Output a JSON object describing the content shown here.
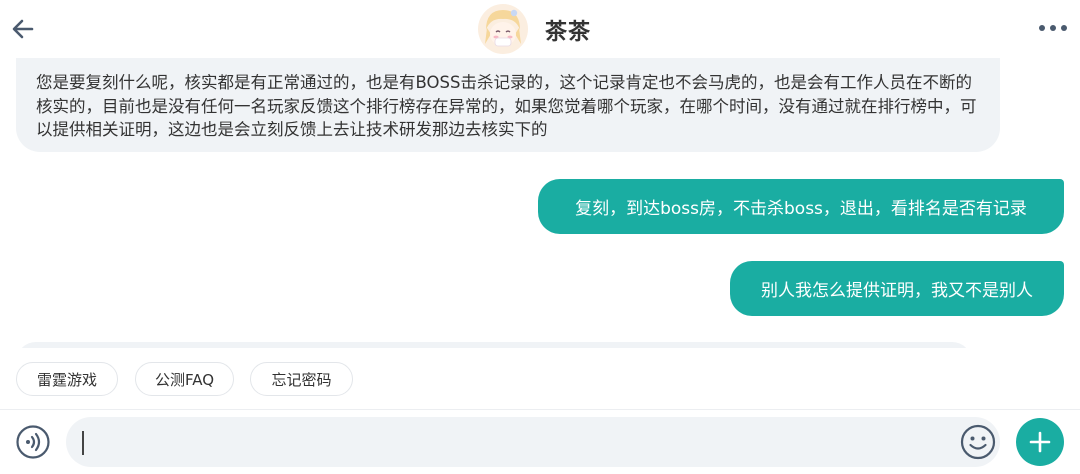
{
  "header": {
    "title": "茶茶"
  },
  "messages": {
    "incoming_1": "您是要复刻什么呢，核实都是有正常通过的，也是有BOSS击杀记录的，这个记录肯定也不会马虎的，也是会有工作人员在不断的核实的，目前也是没有任何一名玩家反馈这个排行榜存在异常的，如果您觉着哪个玩家，在哪个时间，没有通过就在排行榜中，可以提供相关证明，这边也是会立刻反馈上去让技术研发那边去核实下的",
    "outgoing_1": "复刻，到达boss房，不击杀boss，退出，看排名是否有记录",
    "outgoing_2": "别人我怎么提供证明，我又不是别人"
  },
  "quick_replies": [
    "雷霆游戏",
    "公测FAQ",
    "忘记密码"
  ],
  "composer": {
    "value": ""
  },
  "colors": {
    "accent": "#1aada2",
    "bubble_in": "#f0f3f6",
    "icon": "#4a5a6e"
  },
  "icons": {
    "back": "back-arrow-icon",
    "more": "more-dots-icon",
    "voice": "voice-icon",
    "emoji": "emoji-icon",
    "plus": "plus-icon"
  }
}
